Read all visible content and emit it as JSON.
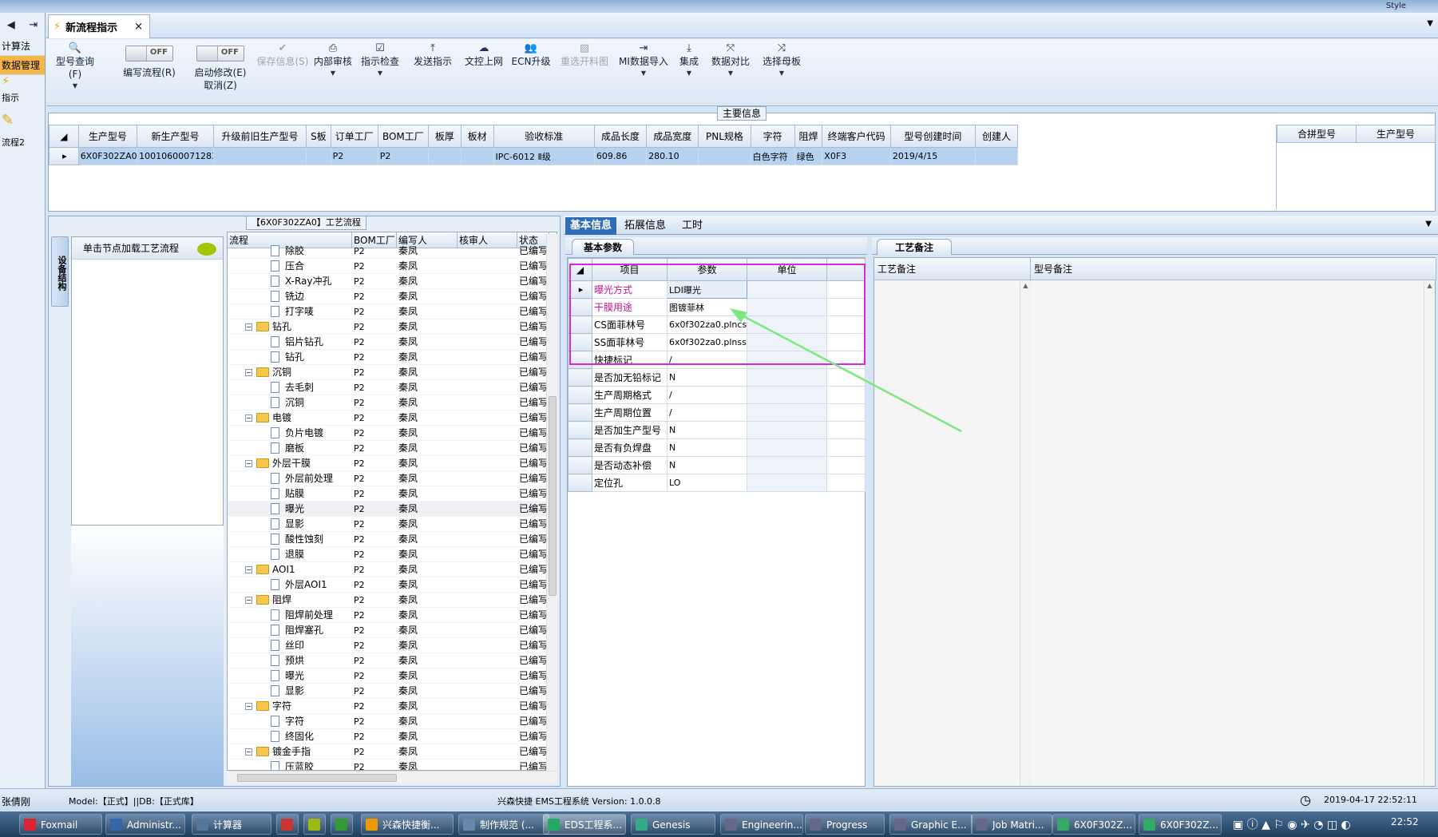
{
  "top": {
    "style_label": "Style"
  },
  "nav": {
    "back_icon": "◀",
    "exit_icon": "⇥",
    "items": [
      {
        "label": "计算法"
      },
      {
        "label": "数据管理"
      },
      {
        "label": "指示"
      },
      {
        "label": "流程2"
      }
    ]
  },
  "tab": {
    "title": "新流程指示",
    "close": "×"
  },
  "toolbar": {
    "search": "型号查询(F)",
    "write_toggle": "OFF",
    "write_label": "编写流程(R)",
    "modify_toggle": "OFF",
    "modify_label": "启动修改(E)",
    "cancel_label": "取消(Z)",
    "save": "保存信息(S)",
    "internal_review": "内部审核",
    "instr_check": "指示检查",
    "send": "发送指示",
    "doc_upload": "文控上网",
    "ecn": "ECN升级",
    "redo_cut": "重选开料图",
    "mi_import": "MI数据导入",
    "integrate": "集成",
    "compare": "数据对比",
    "select_board": "选择母板"
  },
  "main_info": {
    "title": "主要信息",
    "columns": [
      "生产型号",
      "新生产型号",
      "升级前旧生产型号",
      "S板",
      "订单工厂",
      "BOM工厂",
      "板厚",
      "板材",
      "验收标准",
      "成品长度",
      "成品宽度",
      "PNL规格",
      "字符",
      "阻焊",
      "终端客户代码",
      "型号创建时间",
      "创建人"
    ],
    "row": [
      "6X0F302ZA0",
      "10010600071283",
      "",
      "",
      "P2",
      "P2",
      "",
      "",
      "IPC-6012 Ⅱ级",
      "609.86",
      "280.10",
      "",
      "白色字符",
      "绿色",
      "X0F3",
      "2019/4/15",
      ""
    ],
    "combine_columns": [
      "合拼型号",
      "生产型号"
    ]
  },
  "left": {
    "vtab": "设备结构",
    "click_hint": "单击节点加载工艺流程",
    "tree_title": "【6X0F302ZA0】工艺流程",
    "tree_columns": [
      "流程",
      "BOM工厂",
      "编写人",
      "核审人",
      "状态"
    ],
    "rows": [
      {
        "level": 2,
        "type": "doc",
        "name": "除胶",
        "bom": "P2",
        "writer": "秦凤",
        "status": "已编写"
      },
      {
        "level": 2,
        "type": "doc",
        "name": "压合",
        "bom": "P2",
        "writer": "秦凤",
        "status": "已编写"
      },
      {
        "level": 2,
        "type": "doc",
        "name": "X-Ray冲孔",
        "bom": "P2",
        "writer": "秦凤",
        "status": "已编写"
      },
      {
        "level": 2,
        "type": "doc",
        "name": "铣边",
        "bom": "P2",
        "writer": "秦凤",
        "status": "已编写"
      },
      {
        "level": 2,
        "type": "doc",
        "name": "打字唛",
        "bom": "P2",
        "writer": "秦凤",
        "status": "已编写"
      },
      {
        "level": 1,
        "type": "folder",
        "name": "钻孔",
        "bom": "P2",
        "writer": "秦凤",
        "status": "已编写"
      },
      {
        "level": 2,
        "type": "doc",
        "name": "铝片钻孔",
        "bom": "P2",
        "writer": "秦凤",
        "status": "已编写"
      },
      {
        "level": 2,
        "type": "doc",
        "name": "钻孔",
        "bom": "P2",
        "writer": "秦凤",
        "status": "已编写"
      },
      {
        "level": 1,
        "type": "folder",
        "name": "沉铜",
        "bom": "P2",
        "writer": "秦凤",
        "status": "已编写"
      },
      {
        "level": 2,
        "type": "doc",
        "name": "去毛刺",
        "bom": "P2",
        "writer": "秦凤",
        "status": "已编写"
      },
      {
        "level": 2,
        "type": "doc",
        "name": "沉铜",
        "bom": "P2",
        "writer": "秦凤",
        "status": "已编写"
      },
      {
        "level": 1,
        "type": "folder",
        "name": "电镀",
        "bom": "P2",
        "writer": "秦凤",
        "status": "已编写"
      },
      {
        "level": 2,
        "type": "doc",
        "name": "负片电镀",
        "bom": "P2",
        "writer": "秦凤",
        "status": "已编写"
      },
      {
        "level": 2,
        "type": "doc",
        "name": "磨板",
        "bom": "P2",
        "writer": "秦凤",
        "status": "已编写"
      },
      {
        "level": 1,
        "type": "folder",
        "name": "外层干膜",
        "bom": "P2",
        "writer": "秦凤",
        "status": "已编写"
      },
      {
        "level": 2,
        "type": "doc",
        "name": "外层前处理",
        "bom": "P2",
        "writer": "秦凤",
        "status": "已编写"
      },
      {
        "level": 2,
        "type": "doc",
        "name": "贴膜",
        "bom": "P2",
        "writer": "秦凤",
        "status": "已编写"
      },
      {
        "level": 2,
        "type": "doc",
        "name": "曝光",
        "bom": "P2",
        "writer": "秦凤",
        "status": "已编写",
        "selected": true
      },
      {
        "level": 2,
        "type": "doc",
        "name": "显影",
        "bom": "P2",
        "writer": "秦凤",
        "status": "已编写"
      },
      {
        "level": 2,
        "type": "doc",
        "name": "酸性蚀刻",
        "bom": "P2",
        "writer": "秦凤",
        "status": "已编写"
      },
      {
        "level": 2,
        "type": "doc",
        "name": "退膜",
        "bom": "P2",
        "writer": "秦凤",
        "status": "已编写"
      },
      {
        "level": 1,
        "type": "folder",
        "name": "AOI1",
        "bom": "P2",
        "writer": "秦凤",
        "status": "已编写"
      },
      {
        "level": 2,
        "type": "doc",
        "name": "外层AOI1",
        "bom": "P2",
        "writer": "秦凤",
        "status": "已编写"
      },
      {
        "level": 1,
        "type": "folder",
        "name": "阻焊",
        "bom": "P2",
        "writer": "秦凤",
        "status": "已编写"
      },
      {
        "level": 2,
        "type": "doc",
        "name": "阻焊前处理",
        "bom": "P2",
        "writer": "秦凤",
        "status": "已编写"
      },
      {
        "level": 2,
        "type": "doc",
        "name": "阻焊塞孔",
        "bom": "P2",
        "writer": "秦凤",
        "status": "已编写"
      },
      {
        "level": 2,
        "type": "doc",
        "name": "丝印",
        "bom": "P2",
        "writer": "秦凤",
        "status": "已编写"
      },
      {
        "level": 2,
        "type": "doc",
        "name": "预烘",
        "bom": "P2",
        "writer": "秦凤",
        "status": "已编写"
      },
      {
        "level": 2,
        "type": "doc",
        "name": "曝光",
        "bom": "P2",
        "writer": "秦凤",
        "status": "已编写"
      },
      {
        "level": 2,
        "type": "doc",
        "name": "显影",
        "bom": "P2",
        "writer": "秦凤",
        "status": "已编写"
      },
      {
        "level": 1,
        "type": "folder",
        "name": "字符",
        "bom": "P2",
        "writer": "秦凤",
        "status": "已编写"
      },
      {
        "level": 2,
        "type": "doc",
        "name": "字符",
        "bom": "P2",
        "writer": "秦凤",
        "status": "已编写"
      },
      {
        "level": 2,
        "type": "doc",
        "name": "终固化",
        "bom": "P2",
        "writer": "秦凤",
        "status": "已编写"
      },
      {
        "level": 1,
        "type": "folder",
        "name": "镀金手指",
        "bom": "P2",
        "writer": "秦凤",
        "status": "已编写"
      },
      {
        "level": 2,
        "type": "doc",
        "name": "压蓝胶",
        "bom": "P2",
        "writer": "秦凤",
        "status": "已编写"
      }
    ]
  },
  "right": {
    "tabs": [
      "基本信息",
      "拓展信息",
      "工时"
    ],
    "basic_label": "基本参数",
    "basic_columns": [
      "项目",
      "参数",
      "单位"
    ],
    "basic_rows": [
      {
        "item": "曝光方式",
        "value": "LDI曝光",
        "hl": true,
        "sel": true
      },
      {
        "item": "干膜用途",
        "value": "图镀菲林",
        "hl": true
      },
      {
        "item": "CS面菲林号",
        "value": "6x0f302za0.plncs"
      },
      {
        "item": "SS面菲林号",
        "value": "6x0f302za0.plnss"
      },
      {
        "item": "快捷标记",
        "value": "/"
      },
      {
        "item": "是否加无铅标记",
        "value": "N"
      },
      {
        "item": "生产周期格式",
        "value": "/"
      },
      {
        "item": "生产周期位置",
        "value": "/"
      },
      {
        "item": "是否加生产型号",
        "value": "N"
      },
      {
        "item": "是否有负焊盘",
        "value": "N"
      },
      {
        "item": "是否动态补偿",
        "value": "N"
      },
      {
        "item": "定位孔",
        "value": "LO"
      }
    ],
    "notes_label": "工艺备注",
    "notes_columns": [
      "工艺备注",
      "型号备注"
    ],
    "arrow_color": "#7ee87e",
    "highlight_color": "#d829d8"
  },
  "status": {
    "user": "张倩刚",
    "model": "Model:【正式】||DB:【正式库】",
    "system": "兴森快捷 EMS工程系统 Version: 1.0.0.8",
    "datetime": "2019-04-17 22:52:11"
  },
  "taskbar": {
    "items": [
      "Foxmail",
      "Administr...",
      "计算器",
      "",
      "",
      "",
      "兴森快捷衡...",
      "制作规范 (...",
      "EDS工程系...",
      "Genesis",
      "Engineerin...",
      "Progress",
      "Graphic E...",
      "Job Matri...",
      "6X0F302Z...",
      "6X0F302Z..."
    ],
    "clock": "22:52"
  }
}
